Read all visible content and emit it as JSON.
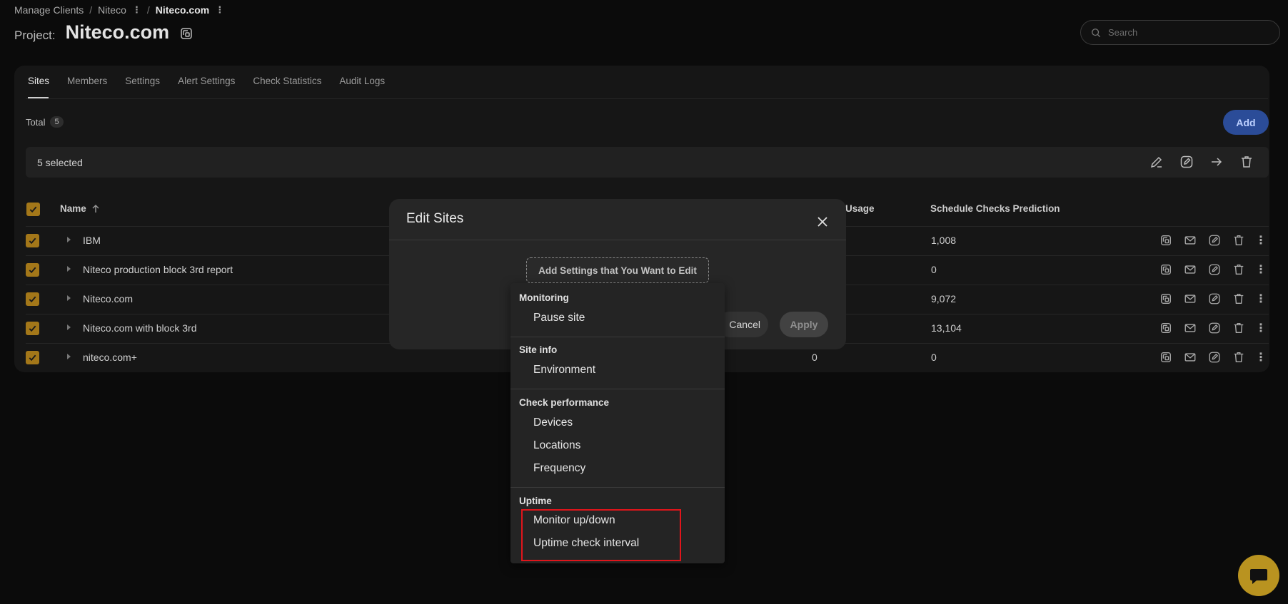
{
  "breadcrumb": {
    "items": [
      "Manage Clients",
      "Niteco",
      "Niteco.com"
    ],
    "separator": "/",
    "menu_glyph": "⋮"
  },
  "project": {
    "label": "Project:",
    "name": "Niteco.com",
    "icon": "open-external-icon"
  },
  "search": {
    "placeholder": "Search",
    "icon": "search-icon"
  },
  "tabs": [
    {
      "label": "Sites",
      "active": true
    },
    {
      "label": "Members",
      "active": false
    },
    {
      "label": "Settings",
      "active": false
    },
    {
      "label": "Alert Settings",
      "active": false
    },
    {
      "label": "Check Statistics",
      "active": false
    },
    {
      "label": "Audit Logs",
      "active": false
    }
  ],
  "summary": {
    "total_label": "Total",
    "total_count": "5",
    "add_label": "Add"
  },
  "selection": {
    "text": "5 selected",
    "actions": [
      "edit-pencil-icon",
      "edit-square-icon",
      "move-arrow-icon",
      "trash-icon"
    ]
  },
  "table": {
    "columns": {
      "name": "Name",
      "usage": "Usage",
      "prediction": "Schedule Checks Prediction"
    },
    "sort": {
      "column": "name",
      "direction": "ascending",
      "icon": "arrow-up-icon"
    },
    "rows": [
      {
        "name": "IBM",
        "usage": "",
        "prediction": "1,008",
        "checked": true
      },
      {
        "name": "Niteco production block 3rd report",
        "usage": "",
        "prediction": "0",
        "checked": true
      },
      {
        "name": "Niteco.com",
        "usage": "",
        "prediction": "9,072",
        "checked": true
      },
      {
        "name": "Niteco.com with block 3rd",
        "usage": "",
        "prediction": "13,104",
        "checked": true
      },
      {
        "name": "niteco.com+",
        "usage": "0",
        "prediction": "0",
        "checked": true
      }
    ],
    "row_actions": [
      "open-external-icon",
      "mail-icon",
      "edit-square-icon",
      "trash-icon",
      "more-vertical-icon"
    ]
  },
  "modal": {
    "title": "Edit Sites",
    "add_settings_label": "Add Settings that You Want to Edit",
    "cancel_label": "Cancel",
    "apply_label": "Apply"
  },
  "dropdown": {
    "groups": [
      {
        "label": "Monitoring",
        "items": [
          "Pause site"
        ]
      },
      {
        "label": "Site info",
        "items": [
          "Environment"
        ]
      },
      {
        "label": "Check performance",
        "items": [
          "Devices",
          "Locations",
          "Frequency"
        ]
      },
      {
        "label": "Uptime",
        "items": [
          "Monitor up/down",
          "Uptime check interval"
        ]
      }
    ],
    "highlight_color": "#e0151b"
  },
  "colors": {
    "background": "#0b0b0b",
    "panel": "#161616",
    "accent_checkbox": "#a37719",
    "add_button": "#2b4c98",
    "chat_button": "#b99320"
  },
  "chat": {
    "icon": "chat-bubble-icon"
  }
}
